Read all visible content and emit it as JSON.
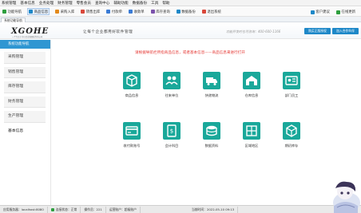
{
  "menu": [
    "系统管理",
    "基本信息",
    "业务处理",
    "财务管理",
    "零售会员",
    "查询中心",
    "辅助功能",
    "数据备份",
    "工具",
    "帮助"
  ],
  "toolbar": {
    "items": [
      {
        "label": "功能导航",
        "color": "#2e9e3e"
      },
      {
        "label": "商品信息",
        "color": "#1e88c8"
      },
      {
        "label": "采购入库",
        "color": "#e38a1b"
      },
      {
        "label": "销售出库",
        "color": "#d9473a"
      },
      {
        "label": "付款单",
        "color": "#3a7bd5"
      },
      {
        "label": "收款单",
        "color": "#3a7bd5"
      },
      {
        "label": "库存查询",
        "color": "#7b52ab"
      },
      {
        "label": "数据备份",
        "color": "#1e88c8"
      },
      {
        "label": "退出系统",
        "color": "#d9473a"
      }
    ],
    "right": [
      {
        "label": "客户建议",
        "color": "#1e88c8"
      },
      {
        "label": "在线更新",
        "color": "#2e9e3e"
      }
    ]
  },
  "tab": {
    "label": "系统功能导航"
  },
  "header": {
    "logo": "XGOHE",
    "logo_sub": "一个专注于中小企业管理软件的公司",
    "slogan": "让每个企业都用好软件管理",
    "hotline": "功能开发时也可咨询：400-600-1166",
    "btn_a": "购买正版授权",
    "btn_b": "加入合作伙伴"
  },
  "sidebar": {
    "head": "系统功能导航",
    "items": [
      "采购管理",
      "销售管理",
      "库存管理",
      "财务管理",
      "生产管理",
      "基本信息"
    ],
    "active_index": 5
  },
  "main": {
    "hint": "请根据导航栏所指商品信息，或者基本信息——商品信息来进行打开",
    "tiles": [
      {
        "label": "商品信息",
        "icon": "product-box-icon"
      },
      {
        "label": "往来单位",
        "icon": "partners-icon"
      },
      {
        "label": "快递物流",
        "icon": "delivery-truck-icon"
      },
      {
        "label": "仓库信息",
        "icon": "warehouse-icon"
      },
      {
        "label": "部门员工",
        "icon": "employee-card-icon"
      },
      {
        "label": "收付款账号",
        "icon": "bank-card-icon"
      },
      {
        "label": "会计科目",
        "icon": "ledger-icon"
      },
      {
        "label": "数据资料",
        "icon": "database-icon"
      },
      {
        "label": "区域地区",
        "icon": "region-map-icon"
      },
      {
        "label": "期初库存",
        "icon": "stock-cube-icon"
      }
    ],
    "tile_color": "#1aa89a"
  },
  "status": {
    "server": "应用服务器：localhost:8080",
    "conn": "连接状态：正常",
    "user": "操作员：221",
    "machine": "运营账户：超级账户",
    "time": "当前时间：2022-05-10 09:13"
  }
}
